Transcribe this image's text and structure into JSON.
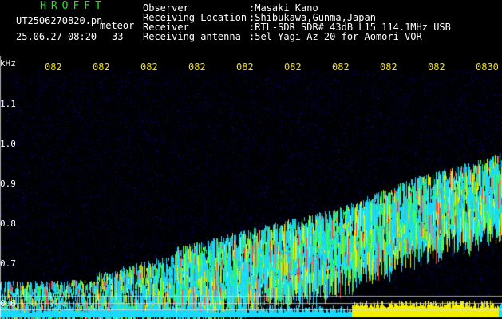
{
  "brand": "HROFFT",
  "file": {
    "name": "UT2506270820.pn",
    "tag": "meteor",
    "date_time": "25.06.27 08:20",
    "count": "33"
  },
  "header": {
    "rows": [
      {
        "label": "Observer",
        "value": ":Masaki Kano"
      },
      {
        "label": "Receiving Location",
        "value": ":Shibukawa,Gunma,Japan"
      },
      {
        "label": "Receiver",
        "value": ":RTL-SDR SDR# 43dB L15 114.1MHz USB"
      },
      {
        "label": "Receiving antenna",
        "value": ":5el Yagi Az 20 for Aomori VOR"
      }
    ]
  },
  "axis": {
    "unit": "kHz",
    "y_ticks": [
      "1.1",
      "1.0",
      "0.9",
      "0.8",
      "0.7",
      "0.6"
    ],
    "time_ticks": [
      "082",
      "082",
      "082",
      "082",
      "082",
      "082",
      "082",
      "082",
      "082",
      "0830"
    ]
  },
  "colors": {
    "brand": "#19f019",
    "time_labels": "#f0e000",
    "text": "#ffffff",
    "background": "#000000",
    "noise": "#0b0b6a",
    "signal_cyan": "#18d9ff",
    "signal_yellow": "#f2ef00",
    "echo_red": "#ff3b3b"
  }
}
